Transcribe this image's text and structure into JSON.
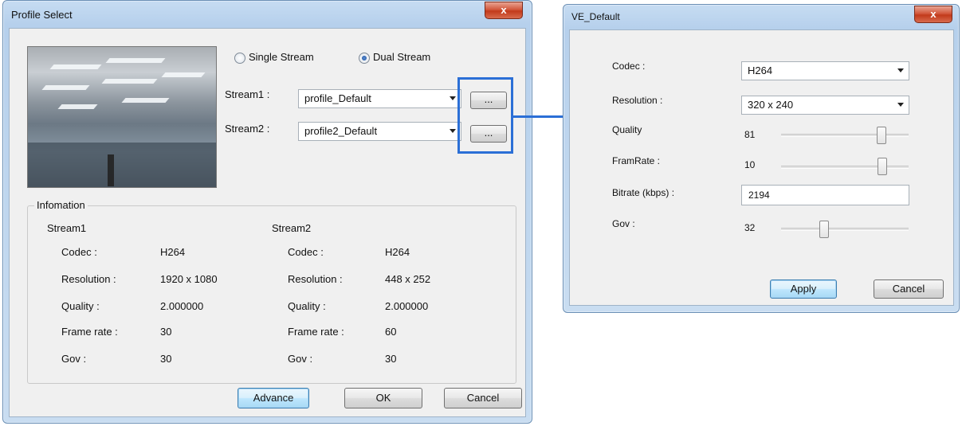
{
  "profile_window": {
    "title": "Profile Select",
    "close_label": "x",
    "mode": {
      "single_label": "Single Stream",
      "dual_label": "Dual Stream",
      "selected": "dual"
    },
    "stream1": {
      "label": "Stream1 :",
      "value": "profile_Default",
      "browse_label": "..."
    },
    "stream2": {
      "label": "Stream2 :",
      "value": "profile2_Default",
      "browse_label": "..."
    },
    "info": {
      "group_title": "Infomation",
      "stream1": {
        "heading": "Stream1",
        "rows": [
          {
            "label": "Codec :",
            "value": "H264"
          },
          {
            "label": "Resolution :",
            "value": "1920 x 1080"
          },
          {
            "label": "Quality :",
            "value": "2.000000"
          },
          {
            "label": "Frame rate :",
            "value": "30"
          },
          {
            "label": "Gov :",
            "value": "30"
          }
        ]
      },
      "stream2": {
        "heading": "Stream2",
        "rows": [
          {
            "label": "Codec :",
            "value": "H264"
          },
          {
            "label": "Resolution :",
            "value": "448 x 252"
          },
          {
            "label": "Quality :",
            "value": "2.000000"
          },
          {
            "label": "Frame rate :",
            "value": "60"
          },
          {
            "label": "Gov :",
            "value": "30"
          }
        ]
      }
    },
    "buttons": {
      "advance": "Advance",
      "ok": "OK",
      "cancel": "Cancel"
    }
  },
  "ve_window": {
    "title": "VE_Default",
    "close_label": "x",
    "codec": {
      "label": "Codec :",
      "value": "H264"
    },
    "resolution": {
      "label": "Resolution :",
      "value": "320 x 240"
    },
    "quality": {
      "label": "Quality",
      "value": "81"
    },
    "framerate": {
      "label": "FramRate :",
      "value": "10"
    },
    "bitrate": {
      "label": "Bitrate (kbps) :",
      "value": "2194"
    },
    "gov": {
      "label": "Gov :",
      "value": "32"
    },
    "buttons": {
      "apply": "Apply",
      "cancel": "Cancel"
    }
  },
  "colors": {
    "highlight": "#2b6fd6",
    "close_button": "#c9462a",
    "window_frame": "#b9d1ea"
  }
}
